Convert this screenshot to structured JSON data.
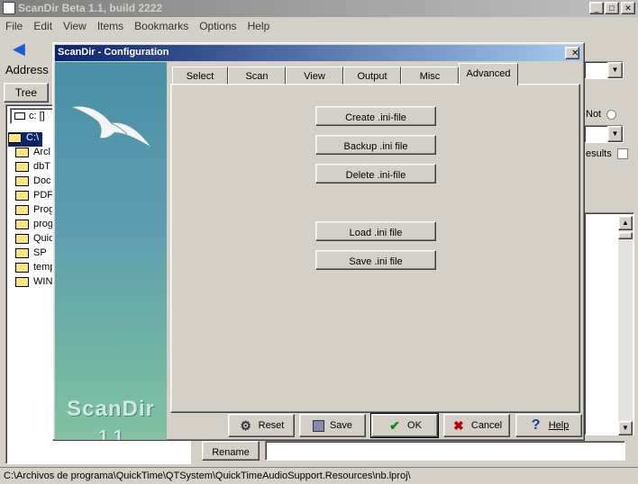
{
  "window": {
    "title": "ScanDir Beta 1.1, build 2222",
    "minimize": "_",
    "maximize": "□",
    "close": "✕"
  },
  "menu": [
    "File",
    "Edit",
    "View",
    "Items",
    "Bookmarks",
    "Options",
    "Help"
  ],
  "address_label": "Address",
  "tree": {
    "tab_label": "Tree",
    "drive": "c: []",
    "root": "C:\\",
    "folders": [
      "Arcl",
      "dbT",
      "Doc",
      "PDF",
      "Prog",
      "prog",
      "Quic",
      "SP",
      "temp",
      "WIN"
    ]
  },
  "right_panel": {
    "not_label": "Not",
    "results_label": "esults"
  },
  "rename_label": "Rename",
  "status_text": "C:\\Archivos de programa\\QuickTime\\QTSystem\\QuickTimeAudioSupport.Resources\\nb.lproj\\",
  "dialog": {
    "title": "ScanDir - Configuration",
    "close": "✕",
    "splash_name": "ScanDir",
    "splash_version": "1.1",
    "tabs": [
      "Select",
      "Scan",
      "View",
      "Output",
      "Misc",
      "Advanced"
    ],
    "active_tab": "Advanced",
    "actions": {
      "create": "Create .ini-file",
      "backup": "Backup .ini file",
      "delete": "Delete .ini-file",
      "load": "Load .ini file",
      "save": "Save .ini file"
    },
    "buttons": {
      "reset": "Reset",
      "save": "Save",
      "ok": "OK",
      "cancel": "Cancel",
      "help": "Help"
    },
    "colors": {
      "title_bar": "#0a246a",
      "ok_check": "#0a8a0a",
      "cancel_x": "#c00000"
    }
  }
}
